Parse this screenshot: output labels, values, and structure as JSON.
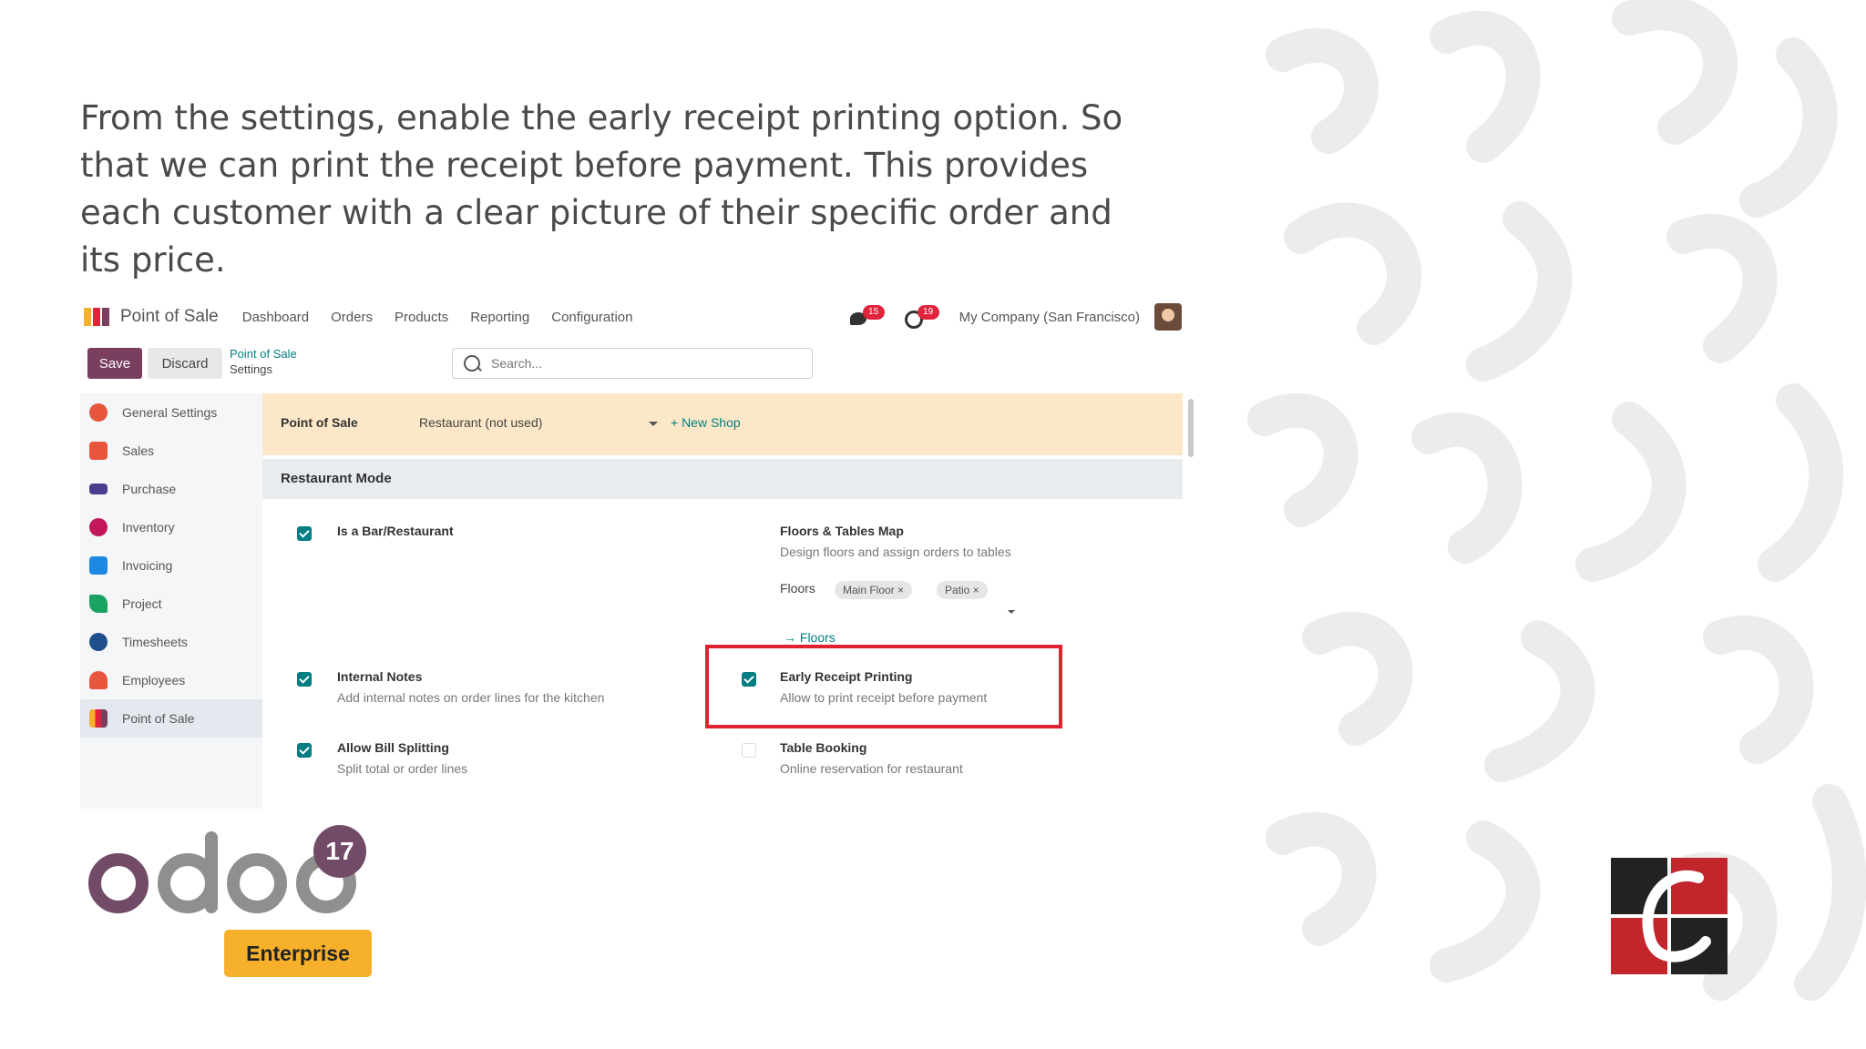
{
  "intro_text": "From the settings, enable the early receipt printing option. So that we can print the receipt before payment. This provides each customer with a clear picture of their specific order and its price.",
  "odoo": {
    "app_name": "Point of Sale",
    "menu": [
      "Dashboard",
      "Orders",
      "Products",
      "Reporting",
      "Configuration"
    ],
    "messages_badge": "15",
    "activities_badge": "19",
    "company": "My Company (San Francisco)",
    "save_label": "Save",
    "discard_label": "Discard",
    "breadcrumb_parent": "Point of Sale",
    "breadcrumb_current": "Settings",
    "search_placeholder": "Search...",
    "sidebar": [
      {
        "label": "General Settings",
        "icon": "gear-icon",
        "color": "#e8553d"
      },
      {
        "label": "Sales",
        "icon": "chart-icon",
        "color": "#e8553d"
      },
      {
        "label": "Purchase",
        "icon": "card-icon",
        "color": "#4a3f8c"
      },
      {
        "label": "Inventory",
        "icon": "box-icon",
        "color": "#c2185b"
      },
      {
        "label": "Invoicing",
        "icon": "invoice-icon",
        "color": "#1e88e5"
      },
      {
        "label": "Project",
        "icon": "check-icon",
        "color": "#1aa260"
      },
      {
        "label": "Timesheets",
        "icon": "clock-icon",
        "color": "#1e4f8c"
      },
      {
        "label": "Employees",
        "icon": "people-icon",
        "color": "#e8553d"
      },
      {
        "label": "Point of Sale",
        "icon": "shop-icon",
        "color": "#c2185b"
      }
    ],
    "pos_label": "Point of Sale",
    "pos_value": "Restaurant (not used)",
    "new_shop": "+ New Shop",
    "section_title": "Restaurant Mode",
    "is_bar_label": "Is a Bar/Restaurant",
    "floors_title": "Floors & Tables Map",
    "floors_desc": "Design floors and assign orders to tables",
    "floors_label": "Floors",
    "floor_tags": [
      "Main Floor ×",
      "Patio ×"
    ],
    "floors_link": "→ Floors",
    "internal_notes_title": "Internal Notes",
    "internal_notes_desc": "Add internal notes on order lines for the kitchen",
    "early_receipt_title": "Early Receipt Printing",
    "early_receipt_desc": "Allow to print receipt before payment",
    "bill_split_title": "Allow Bill Splitting",
    "bill_split_desc": "Split total or order lines",
    "table_booking_title": "Table Booking",
    "table_booking_desc": "Online reservation for restaurant",
    "accent_color": "#017e84",
    "brand_color": "#7a3e5f",
    "highlight_color": "#e0212f"
  },
  "brand": {
    "logo_text": "odoo",
    "version": "17",
    "edition": "Enterprise"
  }
}
